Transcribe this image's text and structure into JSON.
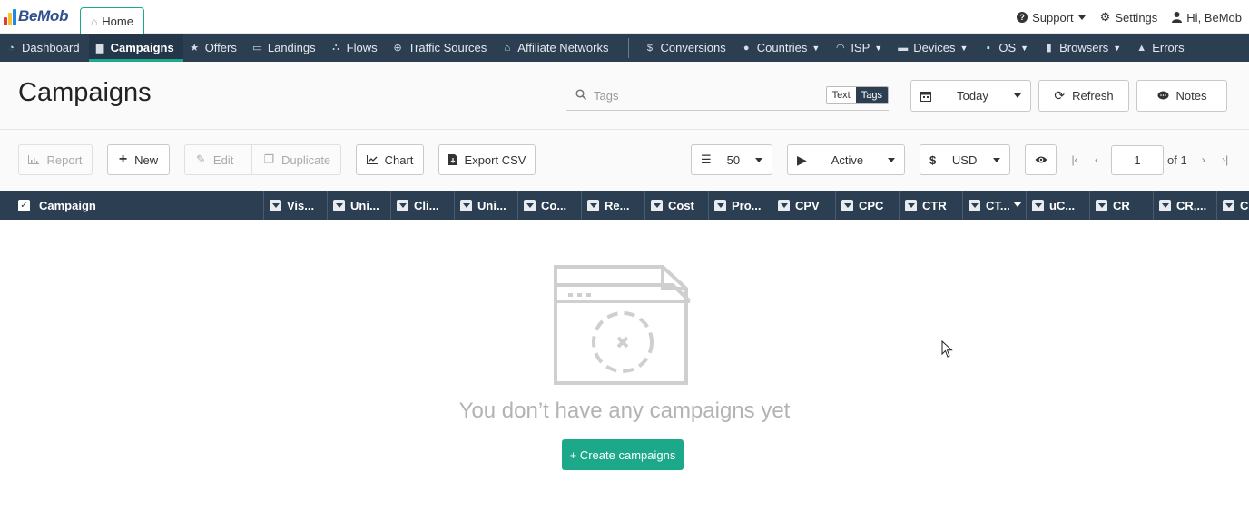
{
  "app": {
    "logo_text": "BeMob",
    "home_tab": "Home"
  },
  "top_right": {
    "support": "Support",
    "settings": "Settings",
    "user": "Hi, BeMob"
  },
  "nav": {
    "primary": [
      {
        "label": "Dashboard",
        "icon": "dashboard-icon"
      },
      {
        "label": "Campaigns",
        "icon": "briefcase-icon",
        "active": true
      },
      {
        "label": "Offers",
        "icon": "star-icon"
      },
      {
        "label": "Landings",
        "icon": "window-icon"
      },
      {
        "label": "Flows",
        "icon": "sitemap-icon"
      },
      {
        "label": "Traffic Sources",
        "icon": "globe-icon"
      },
      {
        "label": "Affiliate Networks",
        "icon": "bank-icon"
      }
    ],
    "secondary": [
      {
        "label": "Conversions",
        "icon": "dollar-icon",
        "dropdown": false
      },
      {
        "label": "Countries",
        "icon": "globe-icon",
        "dropdown": true
      },
      {
        "label": "ISP",
        "icon": "wifi-icon",
        "dropdown": true
      },
      {
        "label": "Devices",
        "icon": "laptop-icon",
        "dropdown": true
      },
      {
        "label": "OS",
        "icon": "android-icon",
        "dropdown": true
      },
      {
        "label": "Browsers",
        "icon": "mobile-icon",
        "dropdown": true
      },
      {
        "label": "Errors",
        "icon": "warning-icon",
        "dropdown": false
      }
    ]
  },
  "header": {
    "title": "Campaigns",
    "tags_placeholder": "Tags",
    "toggle_text": "Text",
    "toggle_tags": "Tags",
    "date_range": "Today",
    "refresh": "Refresh",
    "notes": "Notes"
  },
  "toolbar": {
    "report": "Report",
    "new": "New",
    "edit": "Edit",
    "duplicate": "Duplicate",
    "chart": "Chart",
    "export": "Export CSV",
    "per_page": "50",
    "status": "Active",
    "currency_symbol": "$",
    "currency": "USD",
    "page": "1",
    "of_pages": "of 1"
  },
  "grid": {
    "first_column": "Campaign",
    "columns": [
      "Vis...",
      "Uni...",
      "Cli...",
      "Uni...",
      "Co...",
      "Re...",
      "Cost",
      "Pro...",
      "CPV",
      "CPC",
      "CTR",
      "CT...",
      "uC...",
      "CR",
      "CR,...",
      "CV"
    ]
  },
  "empty_state": {
    "message": "You don’t have any campaigns yet",
    "cta": "+ Create campaigns"
  },
  "colors": {
    "nav_bg": "#2c3f52",
    "accent": "#1ba98a",
    "empty_text": "#b3b3b3"
  }
}
